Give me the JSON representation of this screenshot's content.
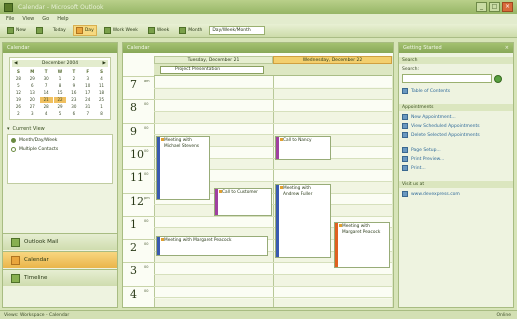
{
  "window": {
    "title": "Calendar - Microsoft Outlook"
  },
  "menu": [
    "File",
    "View",
    "Go",
    "Help"
  ],
  "toolbar": {
    "new_label": "New",
    "today_label": "Today",
    "day_label": "Day",
    "work_week_label": "Work Week",
    "week_label": "Week",
    "month_label": "Month",
    "view_select": "Day/Week/Month"
  },
  "left_pane": {
    "title": "Calendar",
    "minical": {
      "month_label": "December 2004",
      "weekdays": [
        "S",
        "M",
        "T",
        "W",
        "T",
        "F",
        "S"
      ],
      "days": [
        "28",
        "29",
        "30",
        "1",
        "2",
        "3",
        "4",
        "5",
        "6",
        "7",
        "8",
        "9",
        "10",
        "11",
        "12",
        "13",
        "14",
        "15",
        "16",
        "17",
        "18",
        "19",
        "20",
        "21",
        "22",
        "23",
        "24",
        "25",
        "26",
        "27",
        "28",
        "29",
        "30",
        "31",
        "1",
        "2",
        "3",
        "4",
        "5",
        "6",
        "7",
        "8"
      ],
      "selected": [
        "21",
        "22"
      ]
    },
    "current_view_title": "Current View",
    "views": [
      "Month/Day/Week",
      "Multiple Contacts"
    ],
    "nav": {
      "mail": "Outlook Mail",
      "calendar": "Calendar",
      "timeline": "Timeline"
    }
  },
  "calendar": {
    "title": "Calendar",
    "days": [
      "Tuesday, December 21",
      "Wednesday, December 22"
    ],
    "allday_event": "Project Presentation",
    "hours": [
      {
        "num": "7",
        "ampm": "am"
      },
      {
        "num": "8",
        "ampm": "00"
      },
      {
        "num": "9",
        "ampm": "00"
      },
      {
        "num": "10",
        "ampm": "00"
      },
      {
        "num": "11",
        "ampm": "00"
      },
      {
        "num": "12",
        "ampm": "pm"
      },
      {
        "num": "1",
        "ampm": "00"
      },
      {
        "num": "2",
        "ampm": "00"
      },
      {
        "num": "3",
        "ampm": "00"
      },
      {
        "num": "4",
        "ampm": "00"
      }
    ],
    "appointments": [
      {
        "text": "Meeting with Michael Stevens"
      },
      {
        "text": "Call to Customer"
      },
      {
        "text": "Meeting with Margaret Peacock"
      },
      {
        "text": "Call to Nancy"
      },
      {
        "text": "Meeting with Andrew Fuller"
      },
      {
        "text": "Meeting with Margaret Peacock"
      }
    ]
  },
  "right_pane": {
    "title": "Getting Started",
    "section1": "Search",
    "search_label": "Search:",
    "toc_link": "Table of Contents",
    "section2": "Appointments",
    "links": [
      "New Appointment...",
      "View Scheduled Appointments",
      "Delete Selected Appointments"
    ],
    "links2": [
      "Page Setup...",
      "Print Preview...",
      "Print..."
    ],
    "section3": "Visit us at",
    "site": "www.devexpress.com"
  },
  "status": {
    "left": "Views: Workspace - Calendar",
    "right": "Online"
  }
}
